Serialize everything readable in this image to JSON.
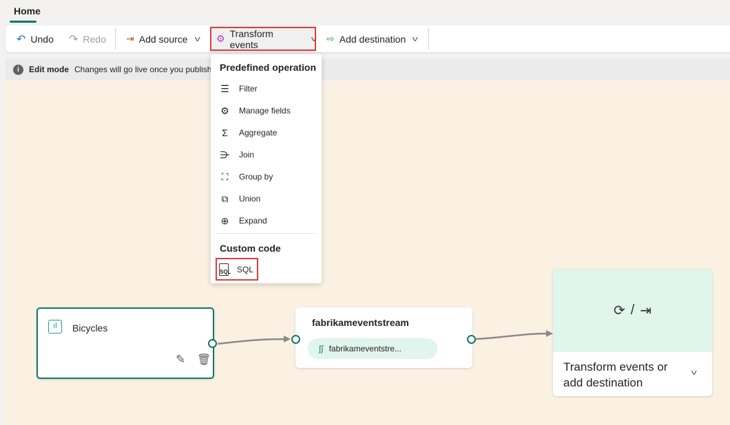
{
  "tabs": [
    {
      "label": "Home",
      "active": true
    }
  ],
  "toolbar": {
    "undo": "Undo",
    "redo": "Redo",
    "add_source": "Add source",
    "transform_events": "Transform events",
    "add_destination": "Add destination"
  },
  "info": {
    "mode": "Edit mode",
    "message": "Changes will go live once you publish"
  },
  "menu": {
    "predefined_header": "Predefined operation",
    "items": [
      {
        "label": "Filter",
        "icon": "filter-icon"
      },
      {
        "label": "Manage fields",
        "icon": "gears-icon"
      },
      {
        "label": "Aggregate",
        "icon": "sigma-icon"
      },
      {
        "label": "Join",
        "icon": "join-icon"
      },
      {
        "label": "Group by",
        "icon": "group-icon"
      },
      {
        "label": "Union",
        "icon": "union-icon"
      },
      {
        "label": "Expand",
        "icon": "expand-icon"
      }
    ],
    "custom_header": "Custom code",
    "sql": "SQL"
  },
  "nodes": {
    "source": {
      "title": "Bicycles"
    },
    "stream": {
      "title": "fabrikameventstream",
      "chip": "fabrikameventstre..."
    },
    "destination": {
      "icons_separator": "/",
      "label": "Transform events or add destination"
    }
  },
  "colors": {
    "accent": "#117865",
    "canvas": "#faf1e2",
    "highlight": "#e03b3b",
    "mint": "#e0f5ec"
  }
}
